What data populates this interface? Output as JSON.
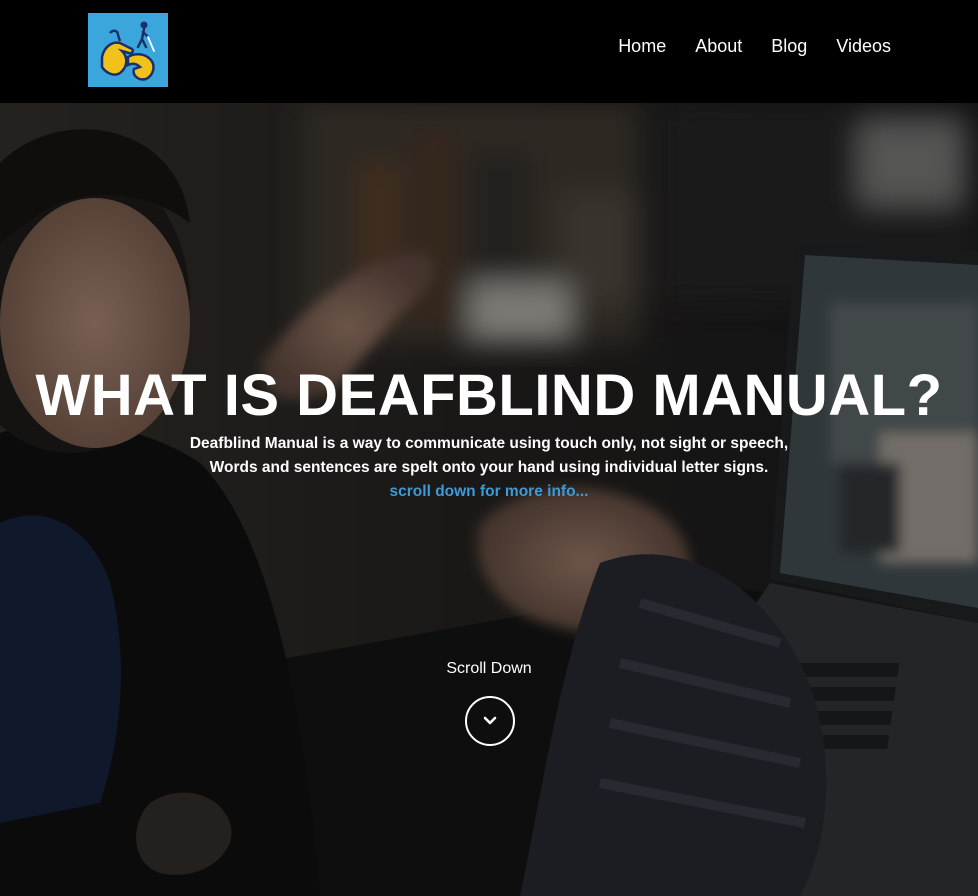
{
  "header": {
    "logo_icon": "deafblind-hands-logo-icon",
    "nav": [
      {
        "label": "Home"
      },
      {
        "label": "About"
      },
      {
        "label": "Blog"
      },
      {
        "label": "Videos"
      }
    ]
  },
  "hero": {
    "title": "WHAT IS DEAFBLIND MANUAL?",
    "line1": "Deafblind Manual is a way to communicate using touch only, not sight or speech,",
    "line2": "Words and sentences are spelt onto your hand using individual letter signs.",
    "more_link": "scroll down for more info...",
    "scroll_label": "Scroll Down",
    "scroll_icon": "chevron-down-icon"
  },
  "colors": {
    "header_bg": "#000000",
    "logo_bg": "#3aa6dc",
    "link_accent": "#3c9bd8",
    "text": "#ffffff"
  }
}
